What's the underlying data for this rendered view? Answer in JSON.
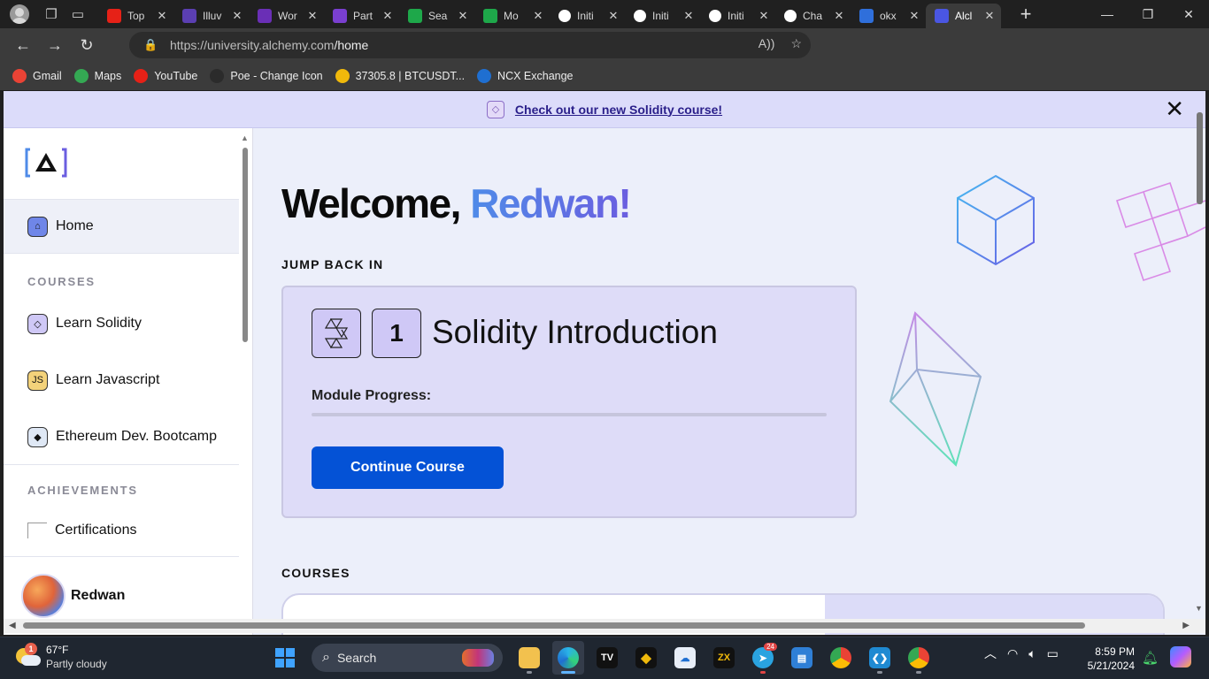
{
  "browser": {
    "tabs": [
      {
        "title": "Top",
        "favicon_color": "#e62117",
        "icon": "youtube-icon"
      },
      {
        "title": "Illuv",
        "favicon_color": "#5b3fb2",
        "icon": "illuvium-icon"
      },
      {
        "title": "Wor",
        "favicon_color": "#6a2fb6",
        "icon": "worldcoin-icon"
      },
      {
        "title": "Part",
        "favicon_color": "#7a3fd0",
        "icon": "swirl-icon"
      },
      {
        "title": "Sea",
        "favicon_color": "#1ea84a",
        "icon": "chart-logo-icon"
      },
      {
        "title": "Mo",
        "favicon_color": "#1ea84a",
        "icon": "chart-logo-icon"
      },
      {
        "title": "Initi",
        "favicon_color": "#ffffff",
        "icon": "initia-icon"
      },
      {
        "title": "Initi",
        "favicon_color": "#ffffff",
        "icon": "initia-icon"
      },
      {
        "title": "Initi",
        "favicon_color": "#ffffff",
        "icon": "initia-icon"
      },
      {
        "title": "Cha",
        "favicon_color": "#ffffff",
        "icon": "chatgpt-icon"
      },
      {
        "title": "okx",
        "favicon_color": "#2f6fdb",
        "icon": "search-icon"
      },
      {
        "title": "Alcl",
        "favicon_color": "#4a56e2",
        "icon": "alchemy-icon",
        "active": true
      }
    ],
    "url_host": "https://university.alchemy.com",
    "url_path": "/home",
    "bookmarks": [
      {
        "label": "Gmail",
        "color": "#ea4335"
      },
      {
        "label": "Maps",
        "color": "#34a853"
      },
      {
        "label": "YouTube",
        "color": "#e62117"
      },
      {
        "label": "Poe - Change Icon",
        "color": "#2b2b2b"
      },
      {
        "label": "37305.8 | BTCUSDT...",
        "color": "#f0b90b"
      },
      {
        "label": "NCX Exchange",
        "color": "#1f6fd1"
      }
    ]
  },
  "banner": {
    "link_text": "Check out our new Solidity course!",
    "close_glyph": "✕"
  },
  "sidebar": {
    "home_label": "Home",
    "courses_heading": "COURSES",
    "courses": [
      {
        "label": "Learn Solidity",
        "icon": "solidity-icon",
        "color": "#cfc8f6"
      },
      {
        "label": "Learn Javascript",
        "icon": "javascript-icon",
        "color": "#f3d27a"
      },
      {
        "label": "Ethereum Dev. Bootcamp",
        "icon": "ethereum-icon",
        "color": "#dfe8f5"
      }
    ],
    "achievements_heading": "ACHIEVEMENTS",
    "certifications_label": "Certifications",
    "user_name": "Redwan"
  },
  "main": {
    "welcome_prefix": "Welcome,",
    "welcome_name": "Redwan!",
    "jump_back_heading": "JUMP BACK IN",
    "module_number": "1",
    "course_title": "Solidity Introduction",
    "progress_label": "Module Progress:",
    "progress_value": 0,
    "continue_label": "Continue Course",
    "courses_heading": "COURSES"
  },
  "taskbar": {
    "temperature": "67°F",
    "condition": "Partly cloudy",
    "weather_alert": "1",
    "search_placeholder": "Search",
    "telegram_count": "24",
    "time": "8:59 PM",
    "date": "5/21/2024"
  }
}
